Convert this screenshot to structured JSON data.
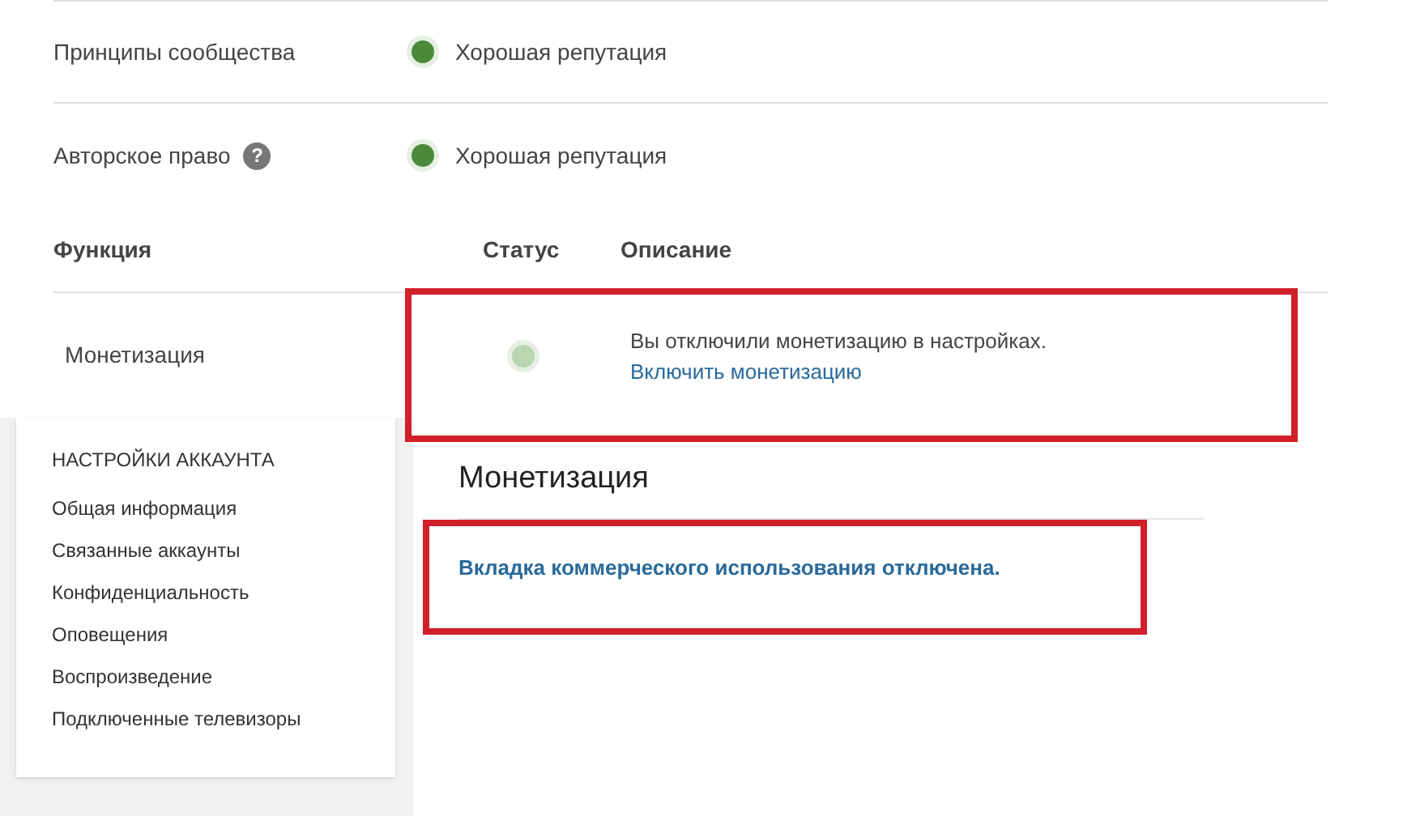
{
  "reputation": [
    {
      "label": "Принципы сообщества",
      "status": "Хорошая репутация",
      "color": "#4a8a3a"
    },
    {
      "label": "Авторское право",
      "help": "?",
      "status": "Хорошая репутация",
      "color": "#4a8a3a"
    }
  ],
  "features": {
    "columns": [
      "Функция",
      "Статус",
      "Описание"
    ],
    "rows": [
      {
        "name": "Монетизация",
        "color": "#b9d6b1",
        "description": "Вы отключили монетизацию в настройках.",
        "link": "Включить монетизацию"
      }
    ]
  },
  "sidebar": {
    "title": "НАСТРОЙКИ АККАУНТА",
    "items": [
      {
        "label": "Общая информация",
        "selected": false
      },
      {
        "label": "Связанные аккаунты",
        "selected": false
      },
      {
        "label": "Конфиденциальность",
        "selected": false
      },
      {
        "label": "Оповещения",
        "selected": false
      },
      {
        "label": "Воспроизведение",
        "selected": false
      },
      {
        "label": "Подключенные телевизоры",
        "selected": false
      }
    ]
  },
  "monetization": {
    "title": "Монетизация",
    "message": "Вкладка коммерческого использования отключена."
  }
}
